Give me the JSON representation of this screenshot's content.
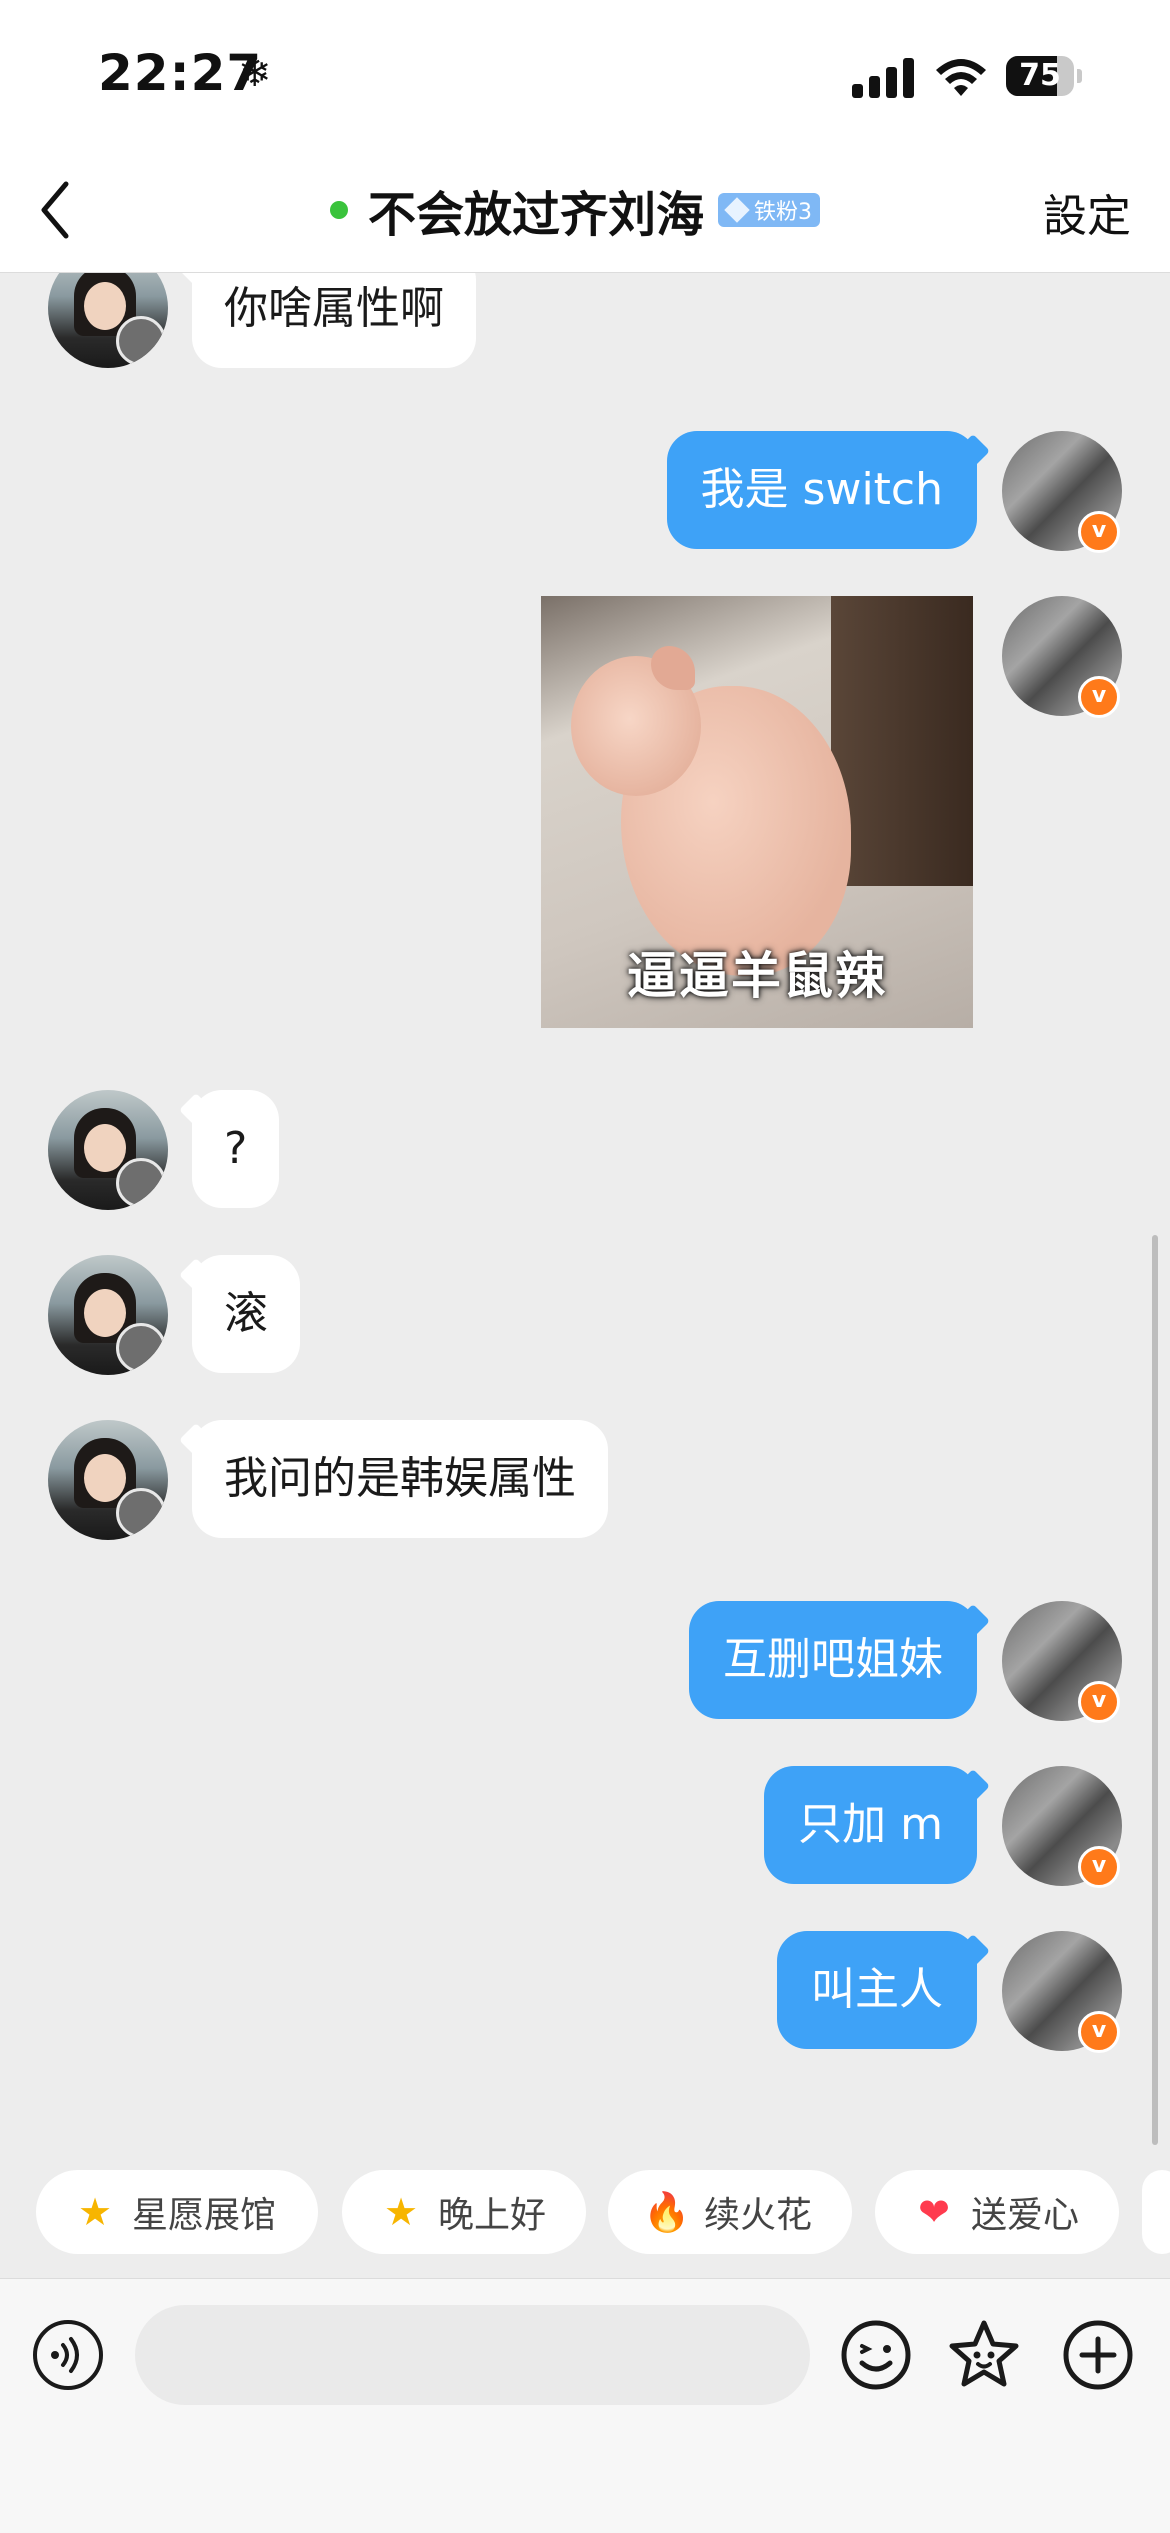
{
  "status_bar": {
    "time": "22:27",
    "snow_glyph": "❄",
    "battery_percent": "75",
    "battery_level": 0.75,
    "icons": [
      "snowflake-icon",
      "signal-icon",
      "wifi-icon",
      "battery-icon"
    ]
  },
  "nav": {
    "back_icon": "chevron-left-icon",
    "title": "不会放过齐刘海",
    "online": true,
    "fan_badge": "铁粉3",
    "settings_label": "設定"
  },
  "messages": [
    {
      "side": "left",
      "type": "text",
      "text": "你啥属性啊"
    },
    {
      "side": "right",
      "type": "text",
      "text": "我是 switch"
    },
    {
      "side": "right",
      "type": "sticker",
      "caption": "逼逼羊鼠辣"
    },
    {
      "side": "left",
      "type": "text",
      "text": "?"
    },
    {
      "side": "left",
      "type": "text",
      "text": "滚"
    },
    {
      "side": "left",
      "type": "text",
      "text": "我问的是韩娱属性"
    },
    {
      "side": "right",
      "type": "text",
      "text": "互删吧姐妹"
    },
    {
      "side": "right",
      "type": "text",
      "text": "只加 m"
    },
    {
      "side": "right",
      "type": "text",
      "text": "叫主人"
    }
  ],
  "avatar_badge": "v",
  "quick_chips": [
    {
      "label": "星愿展馆",
      "icon": "star-icon",
      "glyph": "★",
      "color": "#f7b500"
    },
    {
      "label": "晚上好",
      "icon": "smiling-star-icon",
      "glyph": "★",
      "color": "#f7b500"
    },
    {
      "label": "续火花",
      "icon": "flame-icon",
      "glyph": "🔥",
      "color": "#ff5a2c"
    },
    {
      "label": "送爱心",
      "icon": "heart-icon",
      "glyph": "❤",
      "color": "#ff3b4e"
    }
  ],
  "input_bar": {
    "voice_icon": "voice-icon",
    "placeholder": "",
    "emoji_icon": "emoji-icon",
    "sticker_icon": "star-sticker-icon",
    "plus_icon": "plus-icon"
  }
}
